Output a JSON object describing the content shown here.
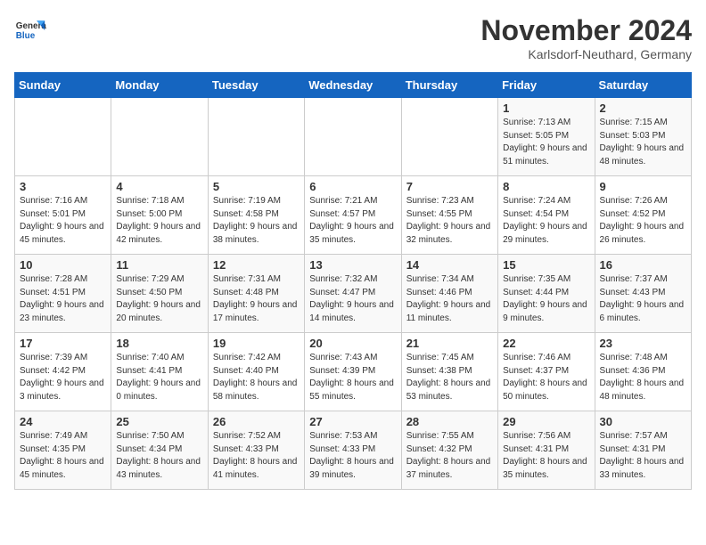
{
  "logo": {
    "line1": "General",
    "line2": "Blue"
  },
  "title": "November 2024",
  "subtitle": "Karlsdorf-Neuthard, Germany",
  "headers": [
    "Sunday",
    "Monday",
    "Tuesday",
    "Wednesday",
    "Thursday",
    "Friday",
    "Saturday"
  ],
  "weeks": [
    [
      {
        "day": "",
        "info": ""
      },
      {
        "day": "",
        "info": ""
      },
      {
        "day": "",
        "info": ""
      },
      {
        "day": "",
        "info": ""
      },
      {
        "day": "",
        "info": ""
      },
      {
        "day": "1",
        "info": "Sunrise: 7:13 AM\nSunset: 5:05 PM\nDaylight: 9 hours\nand 51 minutes."
      },
      {
        "day": "2",
        "info": "Sunrise: 7:15 AM\nSunset: 5:03 PM\nDaylight: 9 hours\nand 48 minutes."
      }
    ],
    [
      {
        "day": "3",
        "info": "Sunrise: 7:16 AM\nSunset: 5:01 PM\nDaylight: 9 hours\nand 45 minutes."
      },
      {
        "day": "4",
        "info": "Sunrise: 7:18 AM\nSunset: 5:00 PM\nDaylight: 9 hours\nand 42 minutes."
      },
      {
        "day": "5",
        "info": "Sunrise: 7:19 AM\nSunset: 4:58 PM\nDaylight: 9 hours\nand 38 minutes."
      },
      {
        "day": "6",
        "info": "Sunrise: 7:21 AM\nSunset: 4:57 PM\nDaylight: 9 hours\nand 35 minutes."
      },
      {
        "day": "7",
        "info": "Sunrise: 7:23 AM\nSunset: 4:55 PM\nDaylight: 9 hours\nand 32 minutes."
      },
      {
        "day": "8",
        "info": "Sunrise: 7:24 AM\nSunset: 4:54 PM\nDaylight: 9 hours\nand 29 minutes."
      },
      {
        "day": "9",
        "info": "Sunrise: 7:26 AM\nSunset: 4:52 PM\nDaylight: 9 hours\nand 26 minutes."
      }
    ],
    [
      {
        "day": "10",
        "info": "Sunrise: 7:28 AM\nSunset: 4:51 PM\nDaylight: 9 hours\nand 23 minutes."
      },
      {
        "day": "11",
        "info": "Sunrise: 7:29 AM\nSunset: 4:50 PM\nDaylight: 9 hours\nand 20 minutes."
      },
      {
        "day": "12",
        "info": "Sunrise: 7:31 AM\nSunset: 4:48 PM\nDaylight: 9 hours\nand 17 minutes."
      },
      {
        "day": "13",
        "info": "Sunrise: 7:32 AM\nSunset: 4:47 PM\nDaylight: 9 hours\nand 14 minutes."
      },
      {
        "day": "14",
        "info": "Sunrise: 7:34 AM\nSunset: 4:46 PM\nDaylight: 9 hours\nand 11 minutes."
      },
      {
        "day": "15",
        "info": "Sunrise: 7:35 AM\nSunset: 4:44 PM\nDaylight: 9 hours\nand 9 minutes."
      },
      {
        "day": "16",
        "info": "Sunrise: 7:37 AM\nSunset: 4:43 PM\nDaylight: 9 hours\nand 6 minutes."
      }
    ],
    [
      {
        "day": "17",
        "info": "Sunrise: 7:39 AM\nSunset: 4:42 PM\nDaylight: 9 hours\nand 3 minutes."
      },
      {
        "day": "18",
        "info": "Sunrise: 7:40 AM\nSunset: 4:41 PM\nDaylight: 9 hours\nand 0 minutes."
      },
      {
        "day": "19",
        "info": "Sunrise: 7:42 AM\nSunset: 4:40 PM\nDaylight: 8 hours\nand 58 minutes."
      },
      {
        "day": "20",
        "info": "Sunrise: 7:43 AM\nSunset: 4:39 PM\nDaylight: 8 hours\nand 55 minutes."
      },
      {
        "day": "21",
        "info": "Sunrise: 7:45 AM\nSunset: 4:38 PM\nDaylight: 8 hours\nand 53 minutes."
      },
      {
        "day": "22",
        "info": "Sunrise: 7:46 AM\nSunset: 4:37 PM\nDaylight: 8 hours\nand 50 minutes."
      },
      {
        "day": "23",
        "info": "Sunrise: 7:48 AM\nSunset: 4:36 PM\nDaylight: 8 hours\nand 48 minutes."
      }
    ],
    [
      {
        "day": "24",
        "info": "Sunrise: 7:49 AM\nSunset: 4:35 PM\nDaylight: 8 hours\nand 45 minutes."
      },
      {
        "day": "25",
        "info": "Sunrise: 7:50 AM\nSunset: 4:34 PM\nDaylight: 8 hours\nand 43 minutes."
      },
      {
        "day": "26",
        "info": "Sunrise: 7:52 AM\nSunset: 4:33 PM\nDaylight: 8 hours\nand 41 minutes."
      },
      {
        "day": "27",
        "info": "Sunrise: 7:53 AM\nSunset: 4:33 PM\nDaylight: 8 hours\nand 39 minutes."
      },
      {
        "day": "28",
        "info": "Sunrise: 7:55 AM\nSunset: 4:32 PM\nDaylight: 8 hours\nand 37 minutes."
      },
      {
        "day": "29",
        "info": "Sunrise: 7:56 AM\nSunset: 4:31 PM\nDaylight: 8 hours\nand 35 minutes."
      },
      {
        "day": "30",
        "info": "Sunrise: 7:57 AM\nSunset: 4:31 PM\nDaylight: 8 hours\nand 33 minutes."
      }
    ]
  ]
}
